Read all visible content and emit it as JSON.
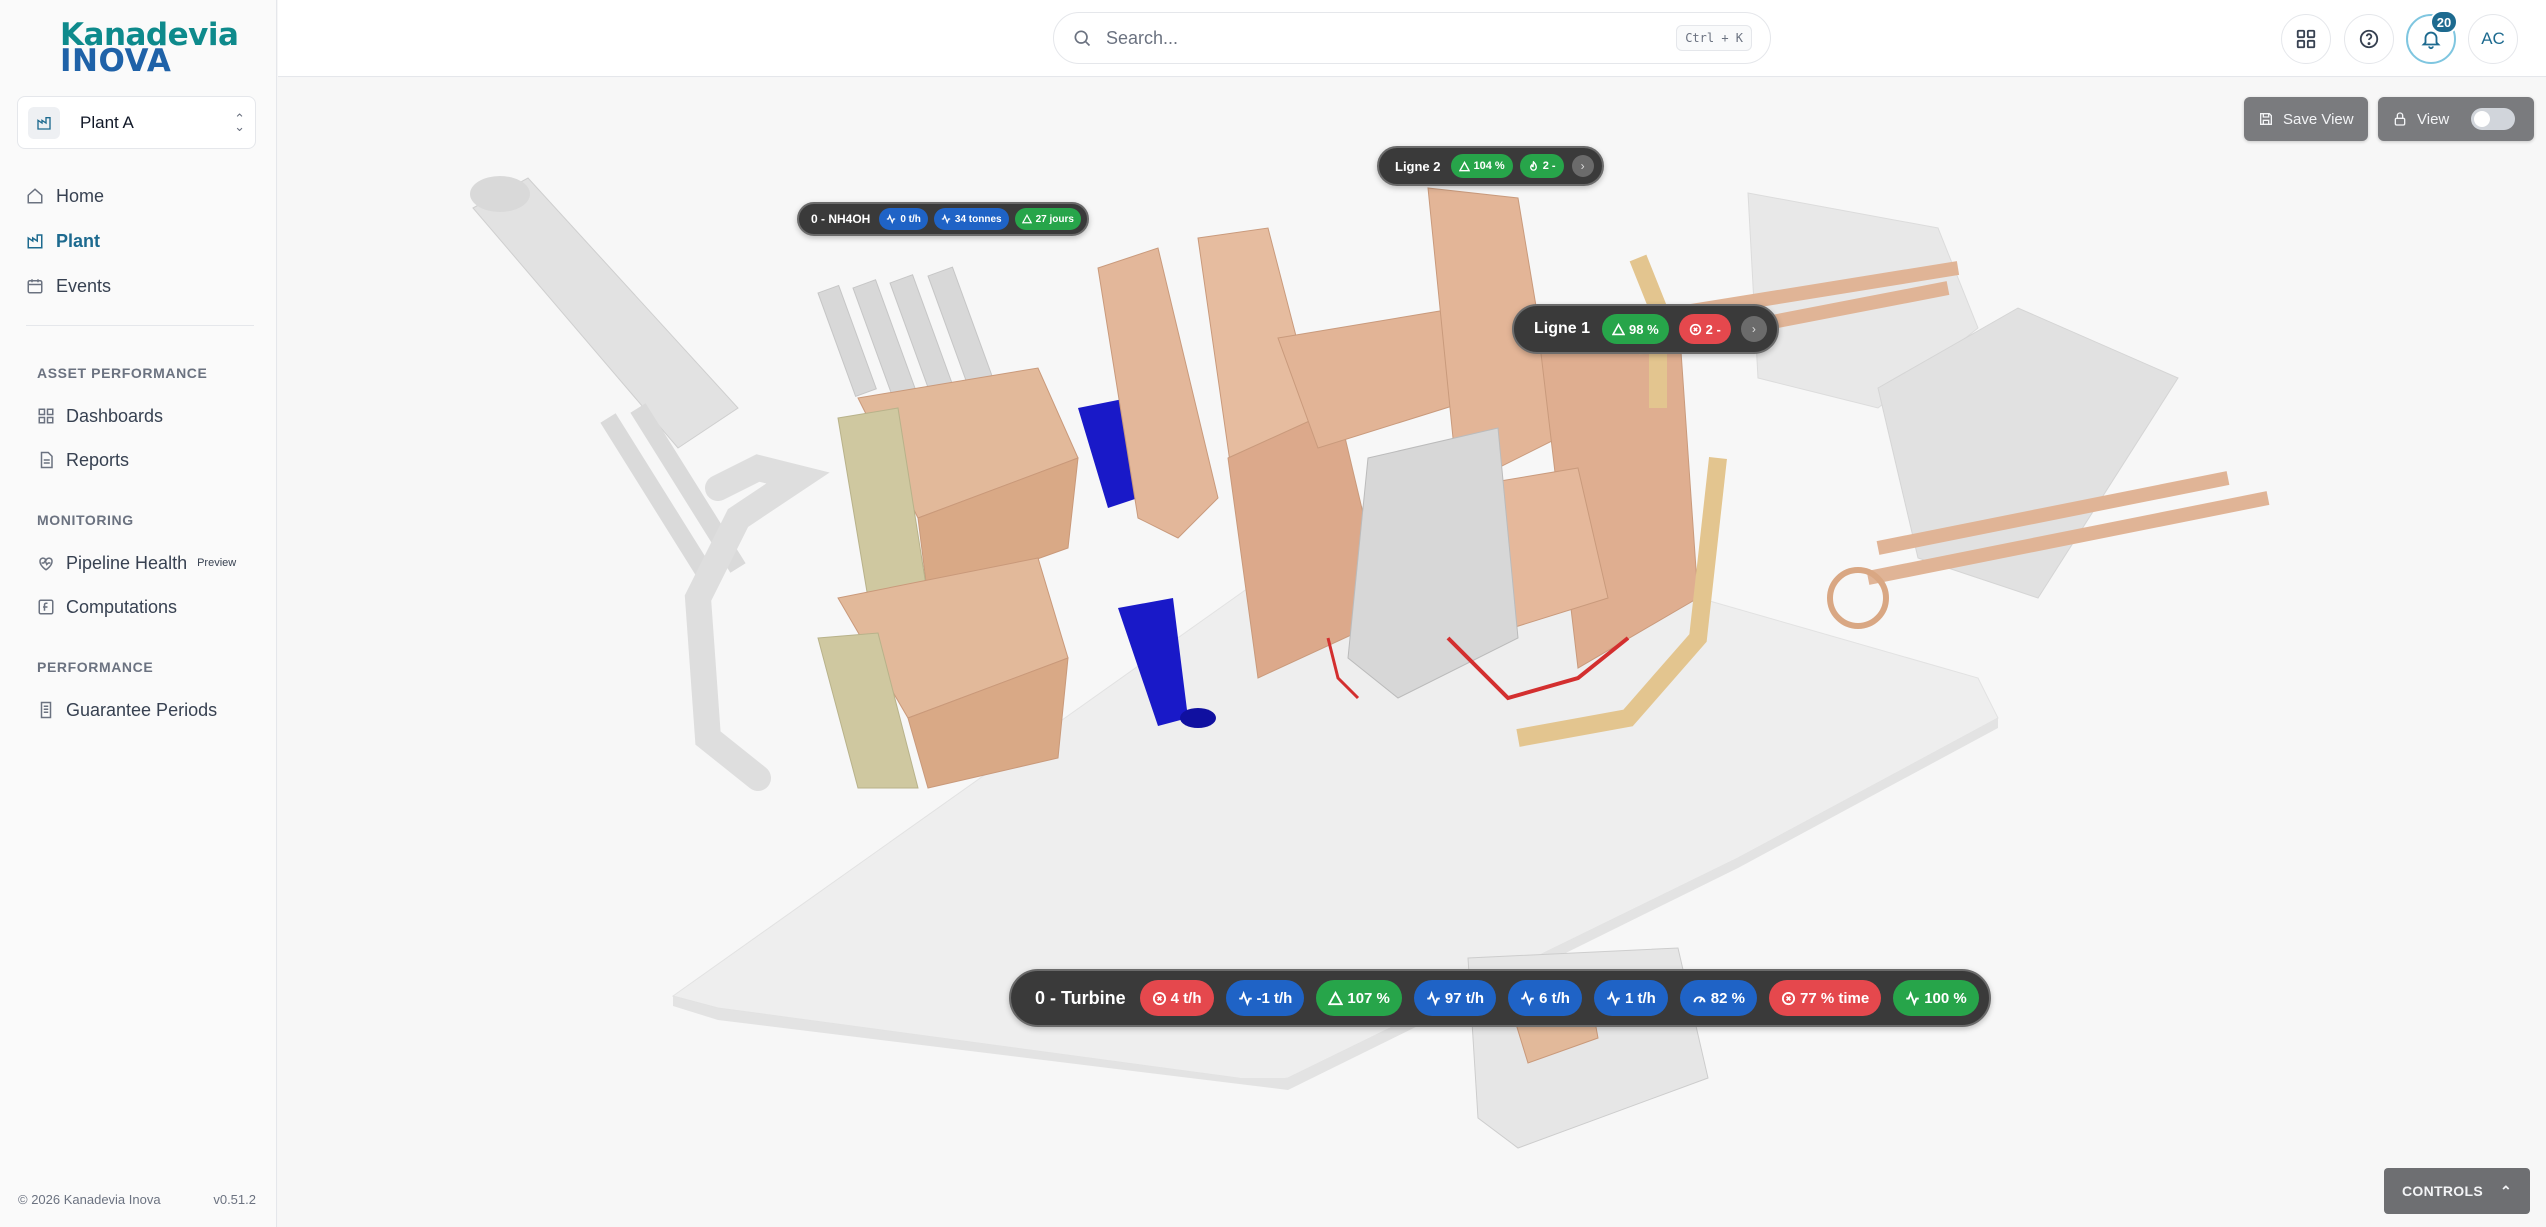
{
  "brand": {
    "line1": "Kanadevia",
    "line2": "INOVA"
  },
  "plant_selector": {
    "value": "Plant A"
  },
  "nav": {
    "home": "Home",
    "plant": "Plant",
    "events": "Events"
  },
  "sections": {
    "asset_performance": {
      "title": "ASSET PERFORMANCE",
      "items": [
        "Dashboards",
        "Reports"
      ]
    },
    "monitoring": {
      "title": "MONITORING",
      "pipeline_health": "Pipeline Health",
      "preview_badge": "Preview",
      "computations": "Computations"
    },
    "performance": {
      "title": "PERFORMANCE",
      "items": [
        "Guarantee Periods"
      ]
    }
  },
  "footer": {
    "copyright": "© 2026 Kanadevia Inova",
    "version": "v0.51.2"
  },
  "search": {
    "placeholder": "Search...",
    "shortcut": "Ctrl + K"
  },
  "header": {
    "notifications": "20",
    "avatar": "AC"
  },
  "toolbar": {
    "save_view": "Save View",
    "view": "View"
  },
  "overlays": {
    "nh4oh": {
      "title": "0 - NH4OH",
      "chips": [
        "0 t/h",
        "34 tonnes",
        "27 jours"
      ]
    },
    "ligne2": {
      "title": "Ligne 2",
      "chips": [
        "104 %",
        "2 -"
      ]
    },
    "ligne1": {
      "title": "Ligne 1",
      "chips": [
        "98 %",
        "2 -"
      ]
    },
    "turbine": {
      "title": "0 - Turbine",
      "chips": [
        "4 t/h",
        "-1 t/h",
        "107 %",
        "97 t/h",
        "6 t/h",
        "1 t/h",
        "82 %",
        "77 % time",
        "100 %"
      ]
    }
  },
  "controls": {
    "label": "CONTROLS"
  },
  "colors": {
    "accent": "#1d6a8f",
    "red": "#e5484d",
    "blue": "#1f63c6",
    "green": "#27a54a"
  }
}
